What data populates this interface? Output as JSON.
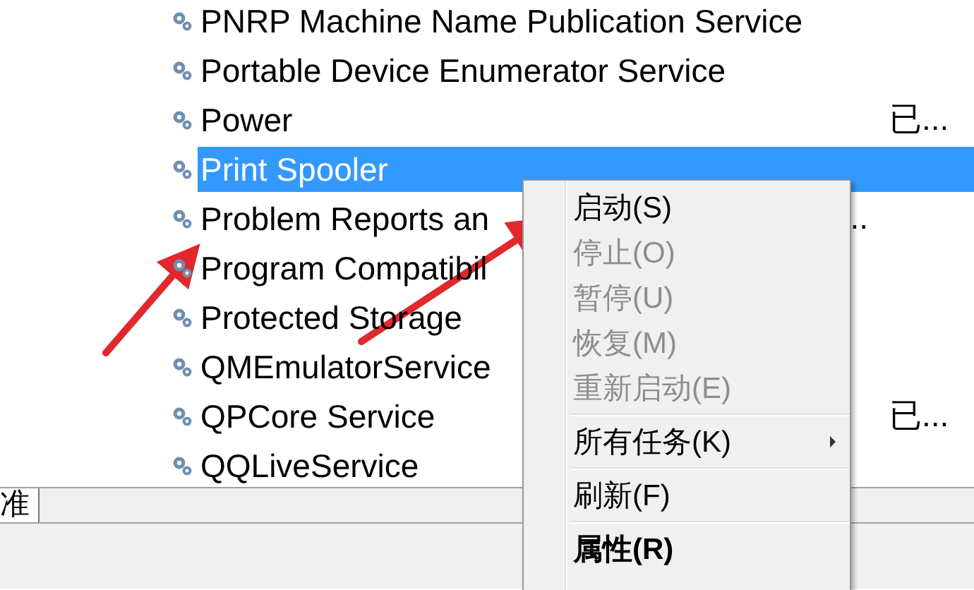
{
  "services": [
    {
      "name": "PNRP Machine Name Publication Service",
      "selected": false
    },
    {
      "name": "Portable Device Enumerator Service",
      "selected": false
    },
    {
      "name": "Power",
      "selected": false,
      "status": "已..."
    },
    {
      "name": "Print Spooler",
      "selected": true
    },
    {
      "name": "Problem Reports an",
      "selected": false,
      "tail": ".."
    },
    {
      "name": "Program Compatibil",
      "selected": false
    },
    {
      "name": "Protected Storage",
      "selected": false
    },
    {
      "name": "QMEmulatorService",
      "selected": false
    },
    {
      "name": "QPCore Service",
      "selected": false,
      "status": "已..."
    },
    {
      "name": "QQLiveService",
      "selected": false
    }
  ],
  "tabs": [
    {
      "label": "准",
      "selected": true
    }
  ],
  "context_menu": [
    {
      "label": "启动(S)",
      "disabled": false
    },
    {
      "label": "停止(O)",
      "disabled": true
    },
    {
      "label": "暂停(U)",
      "disabled": true
    },
    {
      "label": "恢复(M)",
      "disabled": true
    },
    {
      "label": "重新启动(E)",
      "disabled": true
    },
    {
      "label": "所有任务(K)",
      "disabled": false,
      "separator_before": true,
      "submenu": true
    },
    {
      "label": "刷新(F)",
      "disabled": false,
      "separator_before": true
    },
    {
      "label": "属性(R)",
      "disabled": false,
      "separator_before": true,
      "default": true
    }
  ]
}
